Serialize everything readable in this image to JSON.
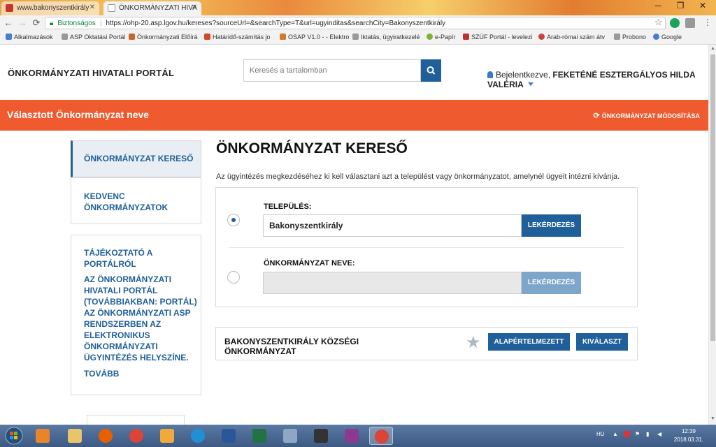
{
  "browser": {
    "tabs": [
      {
        "title": "www.bakonyszentkirály",
        "active": false
      },
      {
        "title": "ÖNKORMÁNYZATI HIVA",
        "active": true
      }
    ],
    "security_label": "Biztonságos",
    "url": "https://ohp-20.asp.lgov.hu/kereses?sourceUrl=&searchType=T&url=ugyinditas&searchCity=Bakonyszentkirály",
    "bookmarks": [
      {
        "label": "Alkalmazások",
        "color": "#4a7bd0"
      },
      {
        "label": "ASP Oktatási Portál",
        "color": "#999999"
      },
      {
        "label": "Önkormányzati Előírá",
        "color": "#c8652a"
      },
      {
        "label": "Határidő-számítás jo",
        "color": "#d04a2a"
      },
      {
        "label": "OSAP V1.0 - - Elektro",
        "color": "#d07a2a"
      },
      {
        "label": "Iktatás, ügyiratkezelé",
        "color": "#999999"
      },
      {
        "label": "e-Papír",
        "color": "#7ab32e"
      },
      {
        "label": "SZÜF Portál - levelezi",
        "color": "#c03030"
      },
      {
        "label": "Arab-római szám átv",
        "color": "#d04040"
      },
      {
        "label": "Probono",
        "color": "#999999"
      },
      {
        "label": "Google",
        "color": "#4a7bd0"
      }
    ]
  },
  "header": {
    "site_title": "ÖNKORMÁNYZATI HIVATALI PORTÁL",
    "search_placeholder": "Keresés a tartalomban",
    "logged_in_label": "Bejelentkezve,",
    "user_name_line1": "FEKETÉNÉ ESZTERGÁLYOS HILDA",
    "user_name_line2": "VALÉRIA"
  },
  "banner": {
    "title": "Választott Önkormányzat neve",
    "modify_label": "ÖNKORMÁNYZAT MÓDOSÍTÁSA"
  },
  "sidebar": {
    "active_item": "ÖNKORMÁNYZAT KERESŐ",
    "fav_line1": "KEDVENC",
    "fav_line2": "ÖNKORMÁNYZATOK",
    "info_title_line1": "TÁJÉKOZTATÓ A",
    "info_title_line2": "PORTÁLRÓL",
    "info_text": [
      "AZ ÖNKORMÁNYZATI",
      "HIVATALI PORTÁL",
      "(TOVÁBBIAKBAN: PORTÁL)",
      "AZ ÖNKORMÁNYZATI ASP",
      "RENDSZERBEN AZ",
      "ELEKTRONIKUS",
      "ÖNKORMÁNYZATI",
      "ÜGYINTÉZÉS HELYSZÍNE."
    ],
    "more_label": "TOVÁBB"
  },
  "main": {
    "title": "ÖNKORMÁNYZAT KERESŐ",
    "description": "Az ügyintézés megkezdéséhez ki kell választani azt a települést vagy önkormányzatot, amelynél ügyeit intézni kívánja.",
    "settlement_label": "TELEPÜLÉS:",
    "settlement_value": "Bakonyszentkirály",
    "query_button": "LEKÉRDEZÉS",
    "municipality_label": "ÖNKORMÁNYZAT NEVE:",
    "municipality_value": "",
    "query_button2": "LEKÉRDEZÉS",
    "selected_option": "település"
  },
  "result": {
    "name_line1": "BAKONYSZENTKIRÁLY KÖZSÉGI",
    "name_line2": "ÖNKORMÁNYZAT",
    "default_button": "ALAPÉRTELMEZETT",
    "select_button": "KIVÁLASZT"
  },
  "taskbar": {
    "language": "HU",
    "time": "12:39",
    "date": "2018.03.31."
  },
  "colors": {
    "accent_blue": "#1f5f9a",
    "banner_orange": "#ef5a2f"
  }
}
